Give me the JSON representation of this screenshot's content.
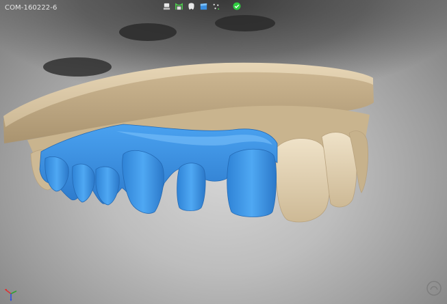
{
  "case": {
    "id": "COM-160222-6"
  },
  "toolbar": {
    "tools": [
      {
        "icon": "model-base-icon"
      },
      {
        "icon": "crown-margin-icon"
      },
      {
        "icon": "tooth-visibility-icon"
      },
      {
        "icon": "wax-up-icon"
      },
      {
        "icon": "points-icon"
      }
    ],
    "status_icon": "check-circle-icon",
    "status_color": "#2ecc40"
  },
  "viewport": {
    "colors": {
      "stone": "#d8c6a6",
      "restoration": "#3a8fe0"
    },
    "axis_icon": "orientation-axes-icon"
  }
}
